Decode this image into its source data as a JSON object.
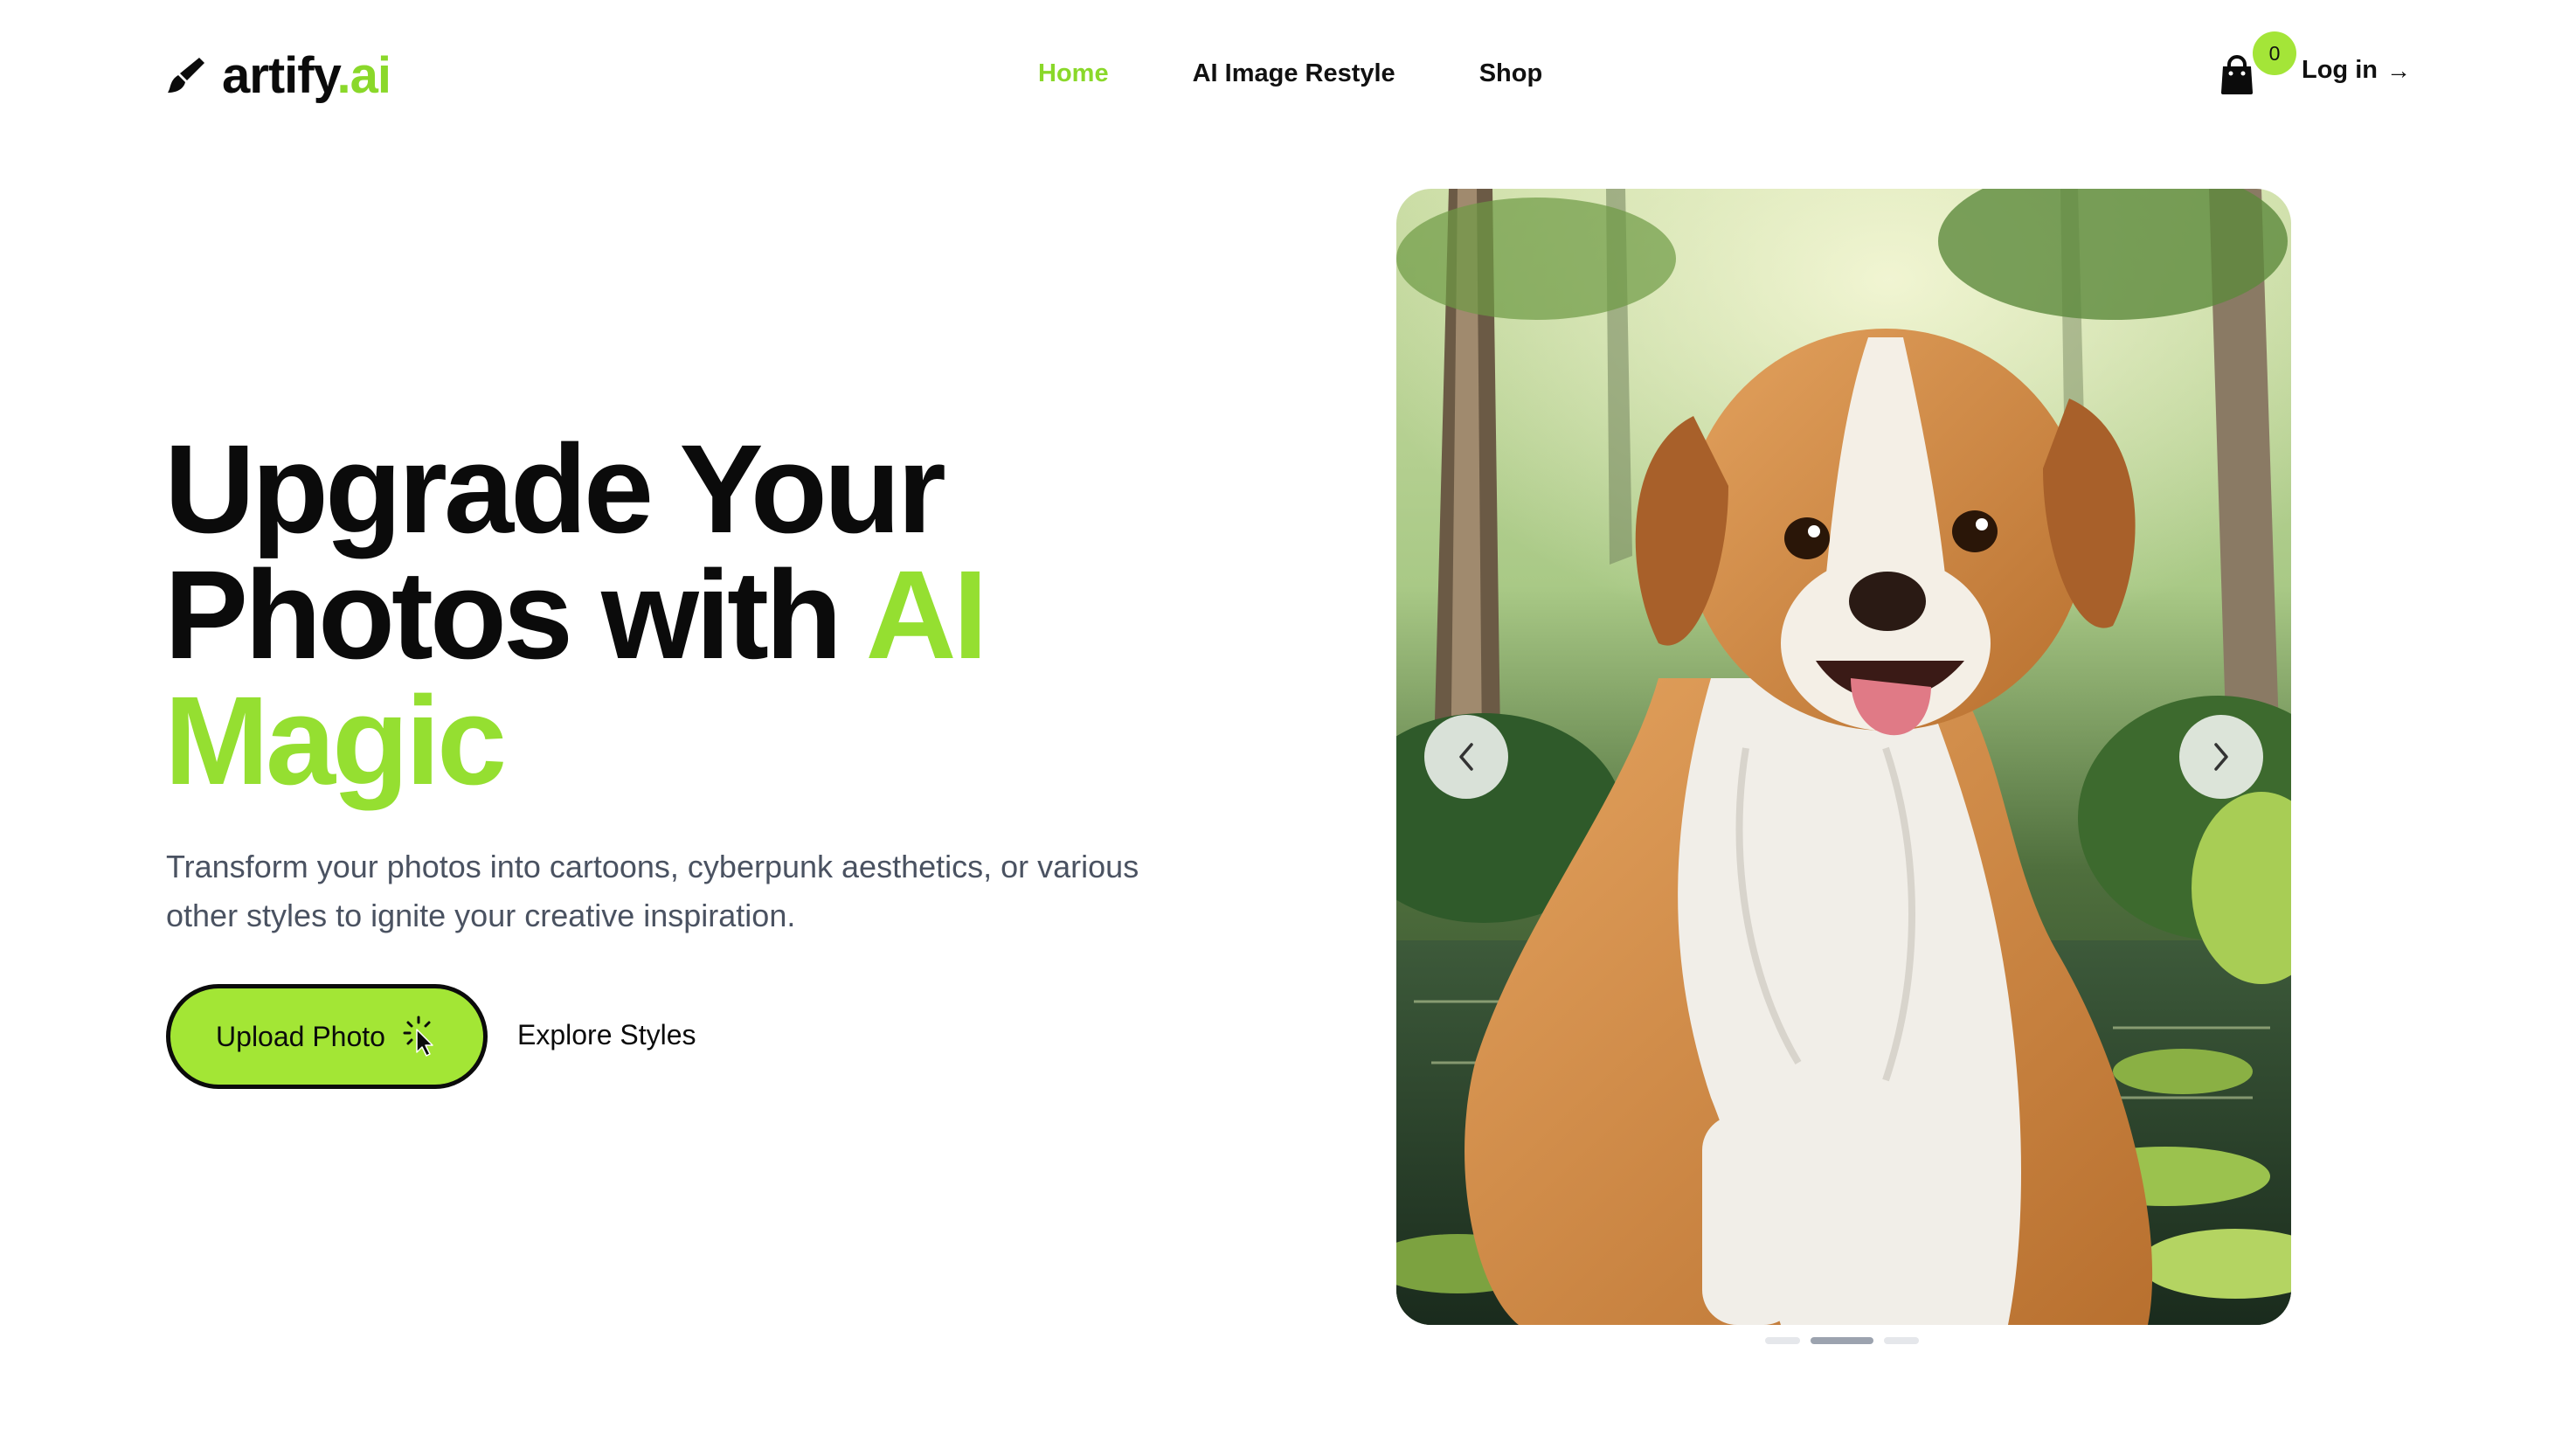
{
  "brand": {
    "name": "artify",
    "suffix": ".ai"
  },
  "nav": {
    "items": [
      {
        "label": "Home",
        "active": true
      },
      {
        "label": "AI Image Restyle",
        "active": false
      },
      {
        "label": "Shop",
        "active": false
      }
    ]
  },
  "header": {
    "cart_count": "0",
    "login_label": "Log in",
    "login_arrow": "→"
  },
  "hero": {
    "title_line1": "Upgrade Your",
    "title_line2_prefix": "Photos with ",
    "title_line2_accent": "AI",
    "title_line3_accent": "Magic",
    "subtitle": "Transform your photos into cartoons, cyberpunk aesthetics, or various other styles to ignite your creative inspiration.",
    "upload_label": "Upload Photo",
    "explore_label": "Explore Styles"
  },
  "carousel": {
    "slide_count": 3,
    "active_index": 1
  },
  "colors": {
    "accent": "#95df31",
    "button": "#a3e635",
    "text": "#0b0b0b",
    "muted": "#4a5261"
  },
  "icons": {
    "logo": "paintbrush-icon",
    "cart": "shopping-bag-icon",
    "upload": "click-cursor-icon",
    "prev": "chevron-left-icon",
    "next": "chevron-right-icon"
  }
}
